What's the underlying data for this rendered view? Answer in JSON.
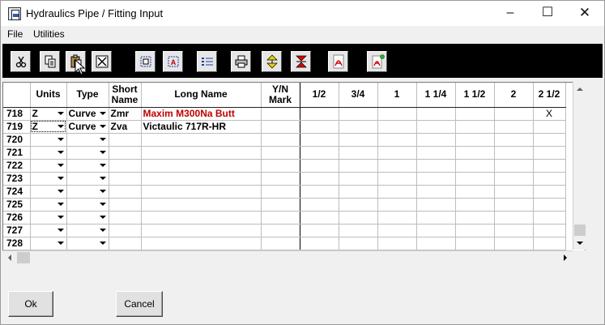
{
  "window": {
    "title": "Hydraulics Pipe / Fitting Input",
    "controls": {
      "minimize": "–",
      "maximize": "☐",
      "close": "✕"
    }
  },
  "menu": [
    "File",
    "Utilities"
  ],
  "toolbar": {
    "buttons": [
      "cut-icon",
      "copy-icon",
      "paste-icon",
      "delete-icon",
      "select-area-icon",
      "find-icon",
      "list-icon",
      "print-icon",
      "expand-rows-icon",
      "collapse-rows-icon",
      "pdf-icon",
      "pdf-export-icon"
    ]
  },
  "grid": {
    "headers": [
      "",
      "Units",
      "Type",
      "Short Name",
      "Long Name",
      "Y/N Mark",
      "1/2",
      "3/4",
      "1",
      "1 1/4",
      "1 1/2",
      "2",
      "2 1/2"
    ],
    "rows": [
      {
        "num": "718",
        "units": "Z",
        "type": "Curve",
        "short": "Zmr",
        "long": "Maxim M300Na Butt",
        "mark": "",
        "s212": "X",
        "highlight": true
      },
      {
        "num": "719",
        "units": "Z",
        "type": "Curve",
        "short": "Zva",
        "long": "Victaulic 717R-HR",
        "mark": "",
        "s212": "",
        "highlight": false
      },
      {
        "num": "720",
        "units": "",
        "type": "",
        "short": "",
        "long": "",
        "mark": "",
        "s212": ""
      },
      {
        "num": "721",
        "units": "",
        "type": "",
        "short": "",
        "long": "",
        "mark": "",
        "s212": ""
      },
      {
        "num": "722",
        "units": "",
        "type": "",
        "short": "",
        "long": "",
        "mark": "",
        "s212": ""
      },
      {
        "num": "723",
        "units": "",
        "type": "",
        "short": "",
        "long": "",
        "mark": "",
        "s212": ""
      },
      {
        "num": "724",
        "units": "",
        "type": "",
        "short": "",
        "long": "",
        "mark": "",
        "s212": ""
      },
      {
        "num": "725",
        "units": "",
        "type": "",
        "short": "",
        "long": "",
        "mark": "",
        "s212": ""
      },
      {
        "num": "726",
        "units": "",
        "type": "",
        "short": "",
        "long": "",
        "mark": "",
        "s212": ""
      },
      {
        "num": "727",
        "units": "",
        "type": "",
        "short": "",
        "long": "",
        "mark": "",
        "s212": ""
      },
      {
        "num": "728",
        "units": "",
        "type": "",
        "short": "",
        "long": "",
        "mark": "",
        "s212": ""
      }
    ],
    "highlight_color": "#c00000"
  },
  "buttons": {
    "ok": "Ok",
    "cancel": "Cancel"
  }
}
